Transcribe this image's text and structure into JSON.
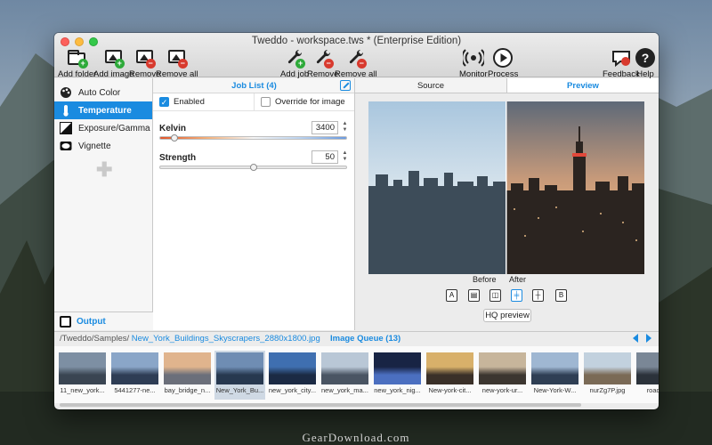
{
  "window": {
    "title": "Tweddo - workspace.tws * (Enterprise Edition)"
  },
  "toolbar": {
    "add_folder": "Add folder",
    "add_image": "Add image",
    "remove": "Remove",
    "remove_all": "Remove all",
    "add_job": "Add job",
    "remove_job": "Remove",
    "remove_all_jobs": "Remove all",
    "monitor": "Monitor",
    "process": "Process",
    "feedback": "Feedback",
    "help": "Help"
  },
  "sidebar": {
    "items": [
      {
        "label": "Auto Color",
        "icon": "palette-icon"
      },
      {
        "label": "Temperature",
        "icon": "thermometer-icon",
        "selected": true
      },
      {
        "label": "Exposure/Gamma",
        "icon": "exposure-icon"
      },
      {
        "label": "Vignette",
        "icon": "vignette-icon"
      }
    ],
    "output_label": "Output"
  },
  "job_list": {
    "title": "Job List (4)",
    "enabled_label": "Enabled",
    "enabled": true,
    "override_label": "Override for image",
    "override": false,
    "kelvin_label": "Kelvin",
    "kelvin_value": "3400",
    "kelvin_level": 0.08,
    "strength_label": "Strength",
    "strength_value": "50",
    "strength_level": 0.5
  },
  "preview": {
    "tab_source": "Source",
    "tab_preview": "Preview",
    "before_label": "Before",
    "after_label": "After",
    "mode_a": "A",
    "mode_b": "B",
    "hq_label": "HQ preview",
    "accent": "#1a8be0"
  },
  "queue": {
    "path": "/Tweddo/Samples/",
    "filename": "New_York_Buildings_Skyscrapers_2880x1800.jpg",
    "title": "Image Queue (13)",
    "thumbs": [
      "11_new_york...",
      "5441277-ne...",
      "bay_bridge_n...",
      "New_York_Bu...",
      "new_york_city...",
      "new_york_ma...",
      "new_york_nig...",
      "New-york-cit...",
      "new-york-ur...",
      "New-York-W...",
      "nurZg7P.jpg",
      "road_n..."
    ]
  },
  "watermark": "GearDownload.com"
}
